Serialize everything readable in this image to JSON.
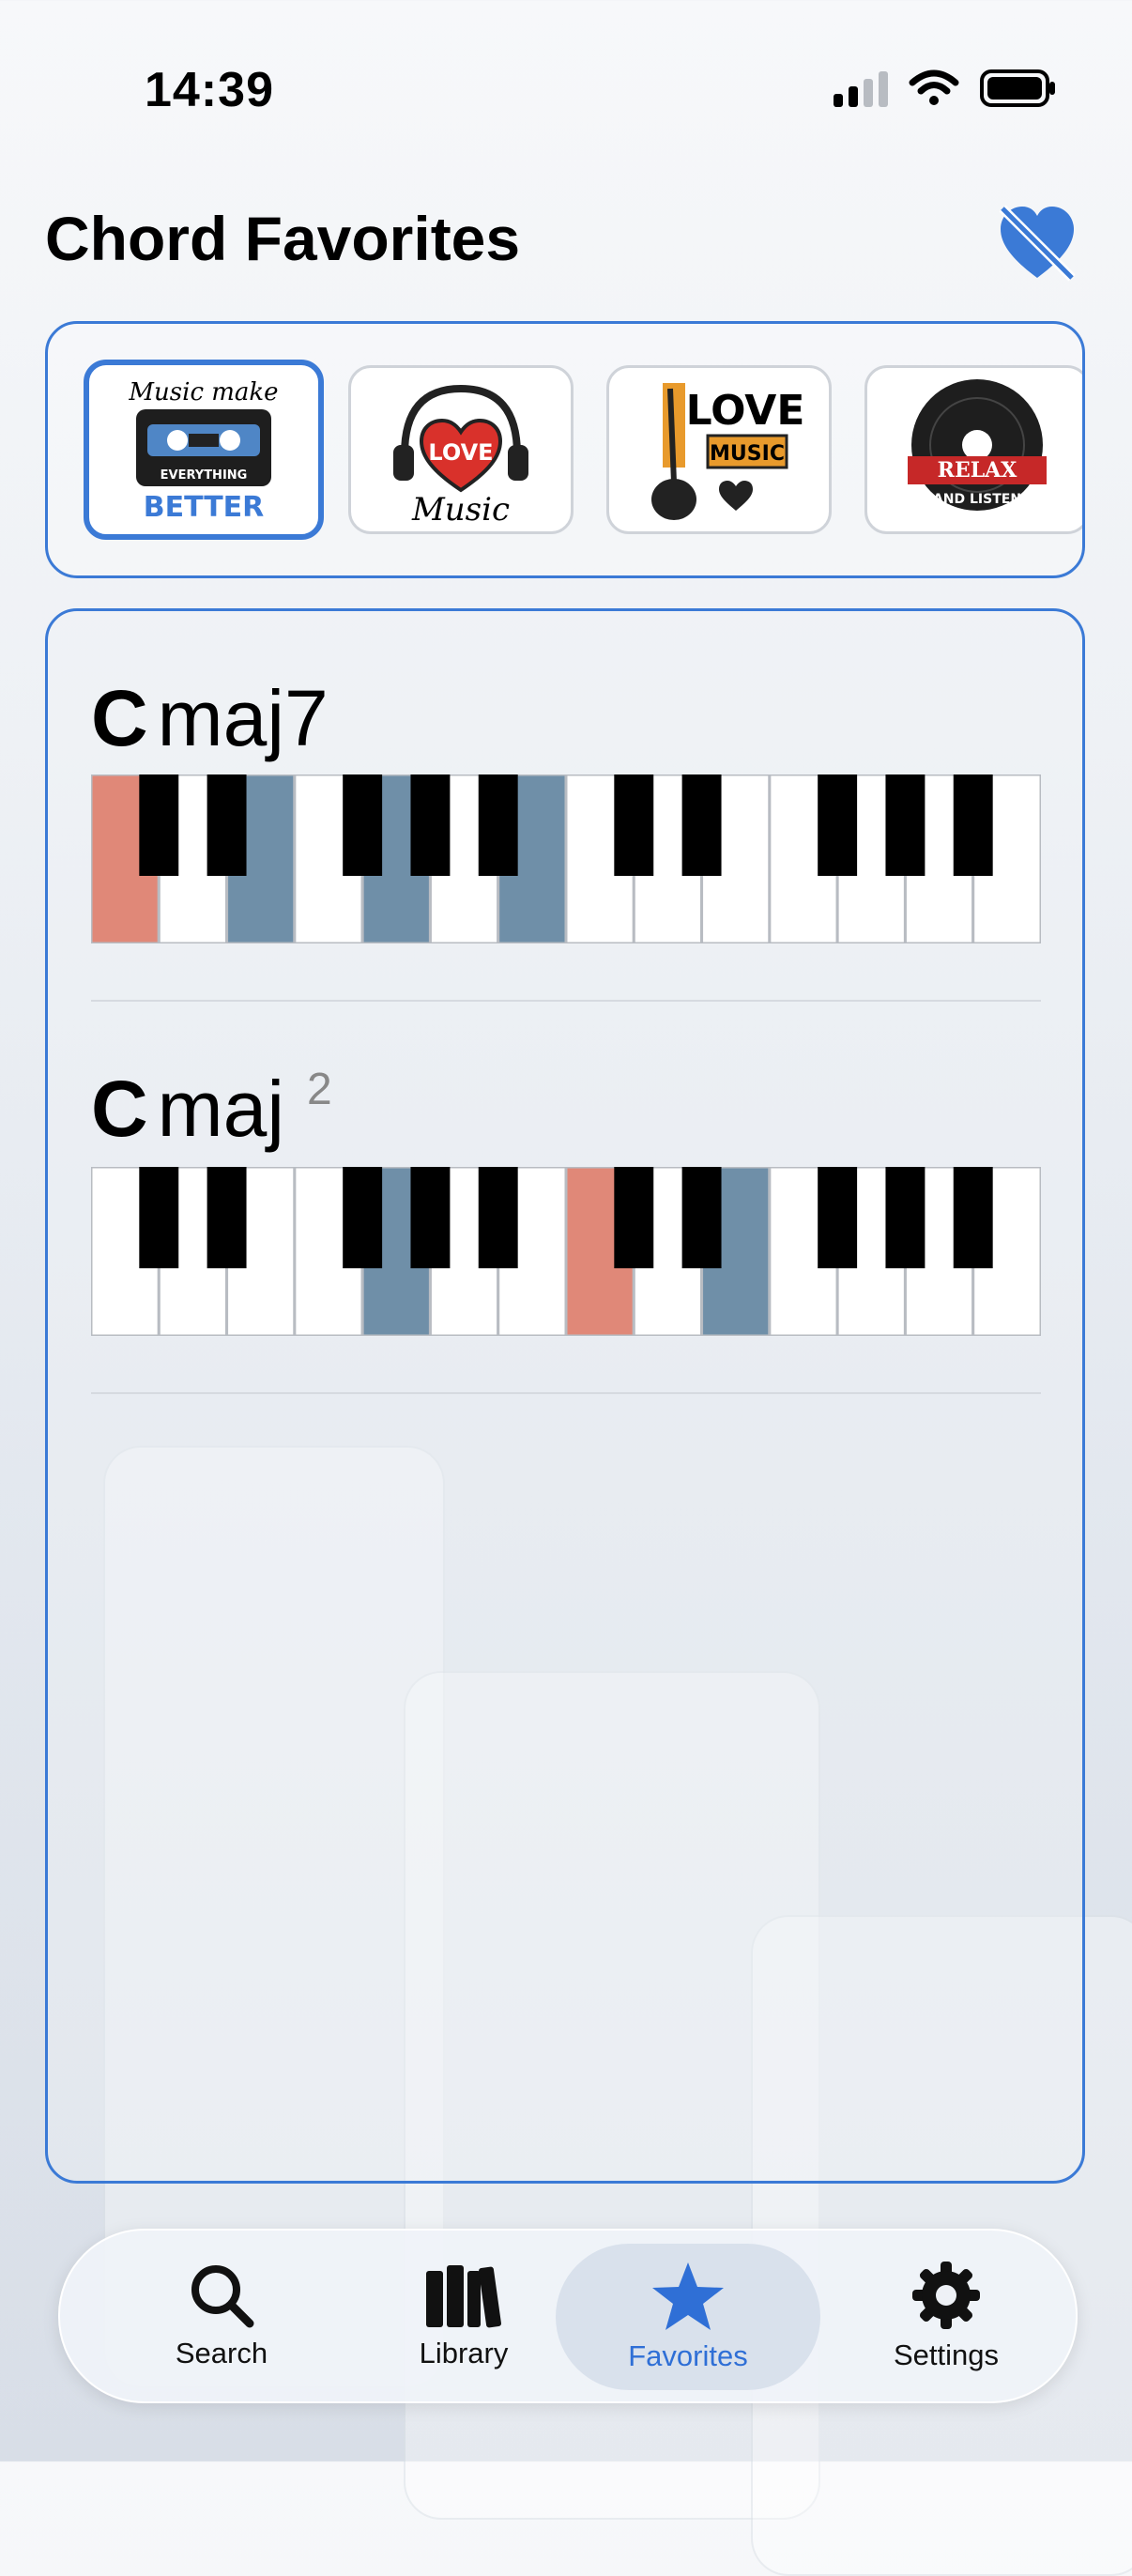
{
  "status": {
    "time": "14:39"
  },
  "header": {
    "title": "Chord Favorites"
  },
  "stickers": [
    {
      "name": "Music make everything better",
      "lines": [
        "Music make",
        "EVERYTHING",
        "BETTER"
      ]
    },
    {
      "name": "Love music",
      "lines": [
        "LOVE",
        "Music"
      ]
    },
    {
      "name": "Love music guitar",
      "lines": [
        "LOVE",
        "MUSIC"
      ]
    },
    {
      "name": "Relax and listen",
      "lines": [
        "RELAX",
        "AND LISTEN"
      ]
    }
  ],
  "chords": [
    {
      "root": "C",
      "quality": "maj7",
      "extension": "",
      "root_key": 0,
      "highlighted_keys": [
        2,
        4,
        6
      ]
    },
    {
      "root": "C",
      "quality": "maj",
      "extension": "2",
      "root_key": 7,
      "highlighted_keys": [
        4,
        9
      ]
    }
  ],
  "colors": {
    "accent": "#3b7ad6",
    "root_key": "#e08878",
    "chord_key": "#6f8fa8"
  },
  "tabs": [
    {
      "label": "Search",
      "icon": "magnifier-icon"
    },
    {
      "label": "Library",
      "icon": "books-icon"
    },
    {
      "label": "Favorites",
      "icon": "star-icon",
      "active": true
    },
    {
      "label": "Settings",
      "icon": "gear-icon"
    }
  ]
}
